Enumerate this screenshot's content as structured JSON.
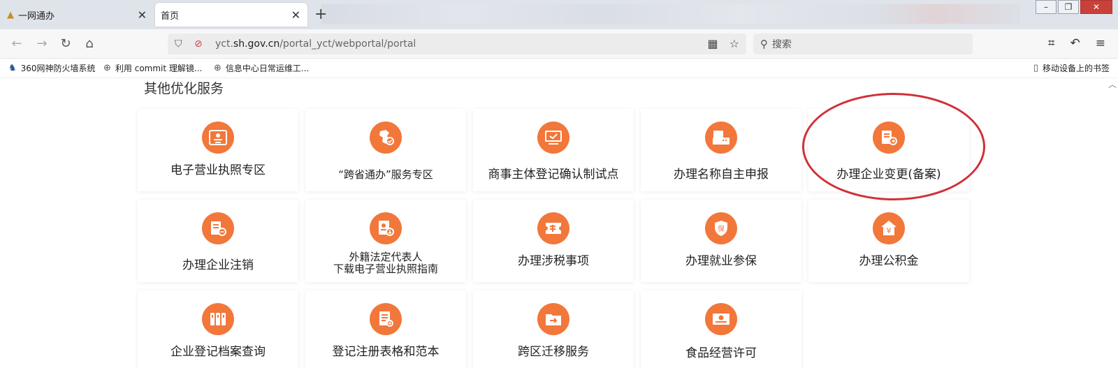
{
  "tabs": [
    {
      "label": "一网通办"
    },
    {
      "label": "首页"
    }
  ],
  "address": {
    "prefix": "yct.",
    "host": "sh.gov.cn",
    "path": "/portal_yct/webportal/portal"
  },
  "search": {
    "placeholder": "搜索"
  },
  "bookmarks": [
    {
      "label": "360网神防火墙系统"
    },
    {
      "label": "利用 commit 理解镜..."
    },
    {
      "label": "信息中心日常运维工..."
    },
    {
      "label": "移动设备上的书签"
    }
  ],
  "section": {
    "title": "其他优化服务"
  },
  "cards": [
    {
      "label": "电子营业执照专区",
      "icon": "license-icon"
    },
    {
      "label": "“跨省通办”服务专区",
      "icon": "map-check-icon"
    },
    {
      "label": "商事主体登记确认制试点",
      "icon": "monitor-check-icon"
    },
    {
      "label": "办理名称自主申报",
      "icon": "printer-icon"
    },
    {
      "label": "办理企业变更(备案)",
      "icon": "document-change-icon"
    },
    {
      "label": "办理企业注销",
      "icon": "document-cancel-icon"
    },
    {
      "label_line1": "外籍法定代表人",
      "label_line2": "下载电子营业执照指南",
      "icon": "id-card-download-icon"
    },
    {
      "label": "办理涉税事项",
      "icon": "tax-ticket-icon"
    },
    {
      "label": "办理就业参保",
      "icon": "insurance-shield-icon"
    },
    {
      "label": "办理公积金",
      "icon": "housing-fund-icon"
    },
    {
      "label": "企业登记档案查询",
      "icon": "archive-folders-icon"
    },
    {
      "label": "登记注册表格和范本",
      "icon": "form-template-icon"
    },
    {
      "label": "跨区迁移服务",
      "icon": "folder-arrow-icon"
    },
    {
      "label": "食品经营许可",
      "icon": "food-certificate-icon"
    }
  ],
  "colors": {
    "accent": "#f2773a",
    "highlight": "#d0303a"
  }
}
